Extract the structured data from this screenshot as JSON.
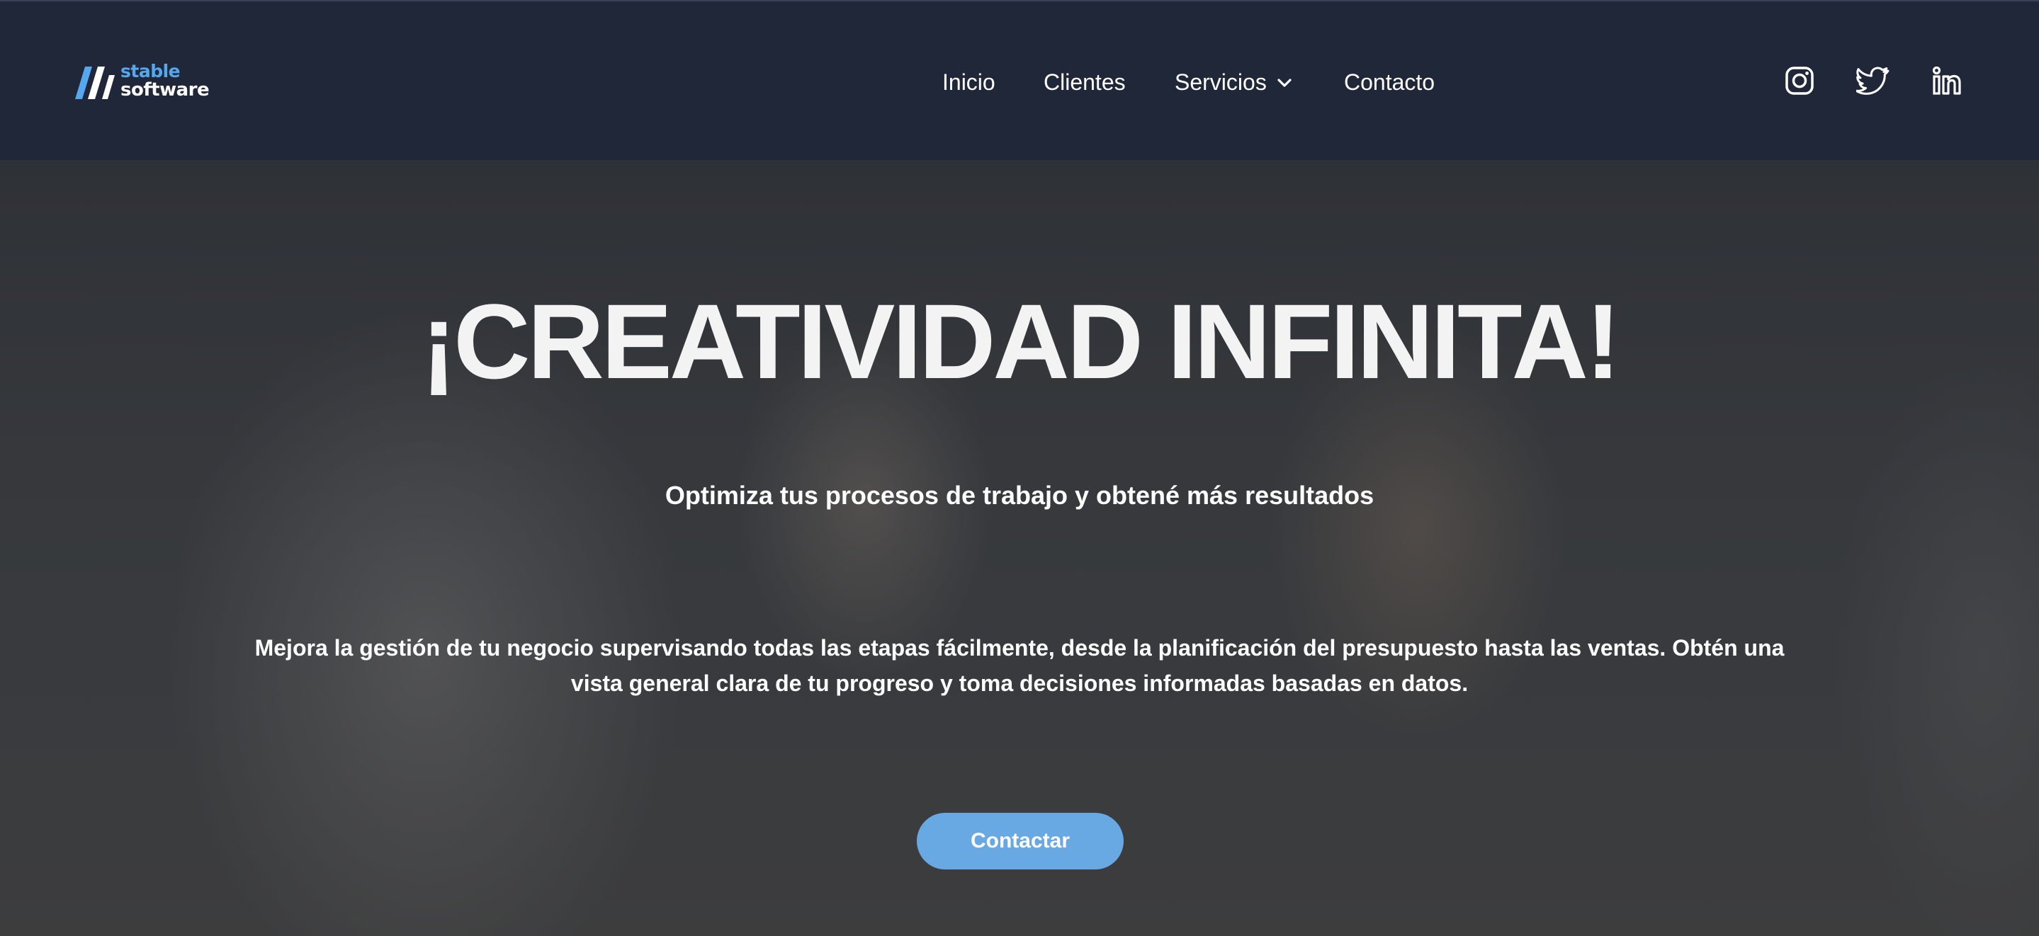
{
  "header": {
    "logo": {
      "line1": "stable",
      "line2": "software"
    },
    "nav": [
      {
        "label": "Inicio"
      },
      {
        "label": "Clientes"
      },
      {
        "label": "Servicios",
        "has_dropdown": true
      },
      {
        "label": "Contacto"
      }
    ],
    "social_icons": [
      "instagram-icon",
      "twitter-icon",
      "linkedin-icon"
    ]
  },
  "hero": {
    "title": "¡CREATIVIDAD INFINITA!",
    "subtitle": "Optimiza tus procesos de trabajo y obtené más resultados",
    "body": "Mejora la gestión de tu negocio supervisando todas las etapas fácilmente, desde la planificación del presupuesto hasta las ventas. Obtén una vista general clara de tu progreso y toma decisiones informadas basadas en datos.",
    "cta_label": "Contactar"
  },
  "colors": {
    "navbar": "#1f2738",
    "accent": "#68a9e3",
    "logo_blue": "#56a8ee"
  }
}
